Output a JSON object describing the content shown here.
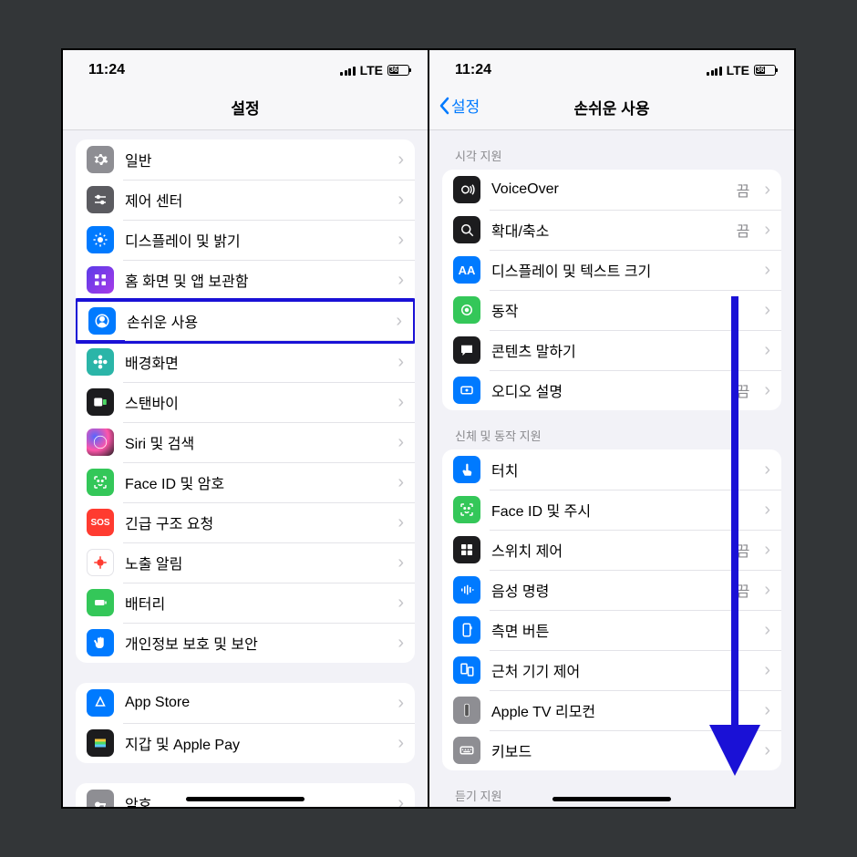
{
  "status": {
    "time": "11:24",
    "carrier": "LTE",
    "battery": "36"
  },
  "left": {
    "title": "설정",
    "group1": [
      {
        "name": "general",
        "label": "일반",
        "bg": "bg-gray",
        "glyph": "gear"
      },
      {
        "name": "control",
        "label": "제어 센터",
        "bg": "bg-dkgray",
        "glyph": "sliders"
      },
      {
        "name": "display",
        "label": "디스플레이 및 밝기",
        "bg": "bg-blue",
        "glyph": "sun"
      },
      {
        "name": "home",
        "label": "홈 화면 및 앱 보관함",
        "bg": "bg-grid",
        "glyph": "grid"
      },
      {
        "name": "access",
        "label": "손쉬운 사용",
        "bg": "bg-blue",
        "glyph": "person",
        "highlight": true
      },
      {
        "name": "wall",
        "label": "배경화면",
        "bg": "bg-teal",
        "glyph": "flower"
      },
      {
        "name": "standby",
        "label": "스탠바이",
        "bg": "bg-black",
        "glyph": "clock"
      },
      {
        "name": "siri",
        "label": "Siri 및 검색",
        "bg": "bg-siri",
        "glyph": "siri"
      },
      {
        "name": "faceid",
        "label": "Face ID 및 암호",
        "bg": "bg-green",
        "glyph": "face"
      },
      {
        "name": "sos",
        "label": "긴급 구조 요청",
        "bg": "bg-red",
        "glyph": "sos"
      },
      {
        "name": "exposure",
        "label": "노출 알림",
        "bg": "bg-white",
        "glyph": "virus"
      },
      {
        "name": "battery",
        "label": "배터리",
        "bg": "bg-green",
        "glyph": "batt"
      },
      {
        "name": "privacy",
        "label": "개인정보 보호 및 보안",
        "bg": "bg-blue",
        "glyph": "hand"
      }
    ],
    "group2": [
      {
        "name": "appstore",
        "label": "App Store",
        "bg": "bg-blue",
        "glyph": "astore"
      },
      {
        "name": "wallet",
        "label": "지갑 및 Apple Pay",
        "bg": "bg-black",
        "glyph": "wallet"
      }
    ],
    "group3": [
      {
        "name": "passwords",
        "label": "암호",
        "bg": "bg-gray",
        "glyph": "key"
      }
    ]
  },
  "right": {
    "back": "설정",
    "title": "손쉬운 사용",
    "sections": [
      {
        "header": "시각 지원",
        "rows": [
          {
            "name": "voiceover",
            "label": "VoiceOver",
            "value": "끔",
            "bg": "bg-black",
            "glyph": "vo"
          },
          {
            "name": "zoom",
            "label": "확대/축소",
            "value": "끔",
            "bg": "bg-black",
            "glyph": "zoom"
          },
          {
            "name": "textsize",
            "label": "디스플레이 및 텍스트 크기",
            "bg": "bg-blue",
            "glyph": "aa"
          },
          {
            "name": "motion",
            "label": "동작",
            "bg": "bg-green",
            "glyph": "motion"
          },
          {
            "name": "speak",
            "label": "콘텐츠 말하기",
            "bg": "bg-black",
            "glyph": "bubble"
          },
          {
            "name": "audiodesc",
            "label": "오디오 설명",
            "value": "끔",
            "bg": "bg-blue",
            "glyph": "ad"
          }
        ]
      },
      {
        "header": "신체 및 동작 지원",
        "rows": [
          {
            "name": "touch",
            "label": "터치",
            "bg": "bg-blue",
            "glyph": "touch"
          },
          {
            "name": "faceatt",
            "label": "Face ID 및 주시",
            "bg": "bg-green",
            "glyph": "face"
          },
          {
            "name": "switch",
            "label": "스위치 제어",
            "value": "끔",
            "bg": "bg-black",
            "glyph": "switch"
          },
          {
            "name": "voicectl",
            "label": "음성 명령",
            "value": "끔",
            "bg": "bg-blue",
            "glyph": "voice"
          },
          {
            "name": "sidebtn",
            "label": "측면 버튼",
            "bg": "bg-blue",
            "glyph": "side"
          },
          {
            "name": "nearby",
            "label": "근처 기기 제어",
            "bg": "bg-blue",
            "glyph": "nearby"
          },
          {
            "name": "appletv",
            "label": "Apple TV 리모컨",
            "bg": "bg-gray",
            "glyph": "remote"
          },
          {
            "name": "keyboard",
            "label": "키보드",
            "bg": "bg-keys",
            "glyph": "keyb"
          }
        ]
      },
      {
        "header": "듣기 지원",
        "rows": []
      }
    ]
  }
}
